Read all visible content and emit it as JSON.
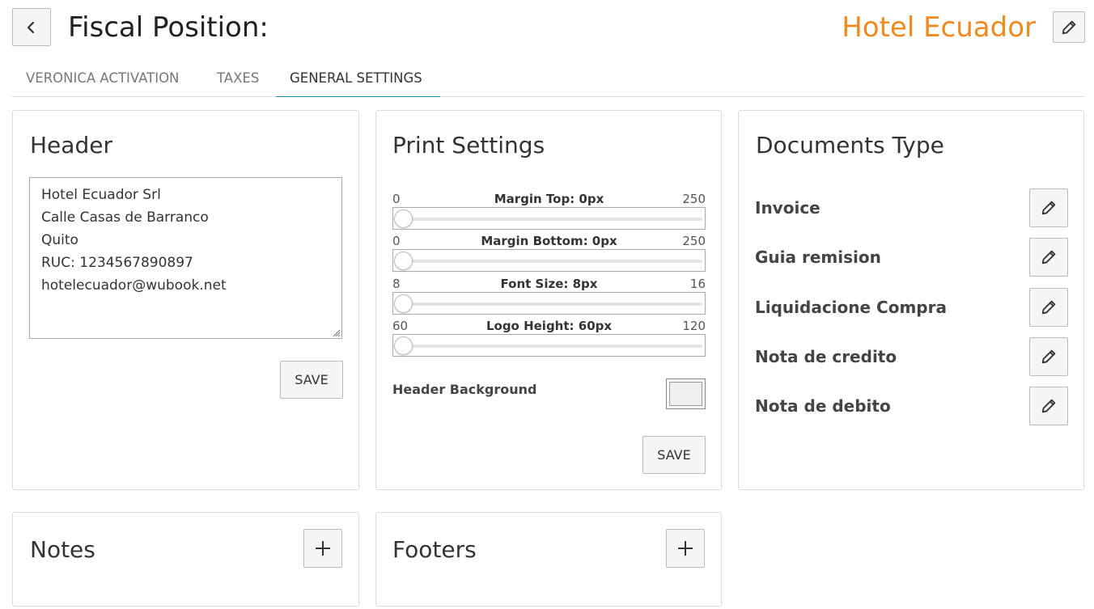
{
  "header": {
    "title": "Fiscal Position:",
    "hotel_name": "Hotel Ecuador"
  },
  "tabs": [
    {
      "label": "VERONICA ACTIVATION",
      "active": false
    },
    {
      "label": "TAXES",
      "active": false
    },
    {
      "label": "GENERAL SETTINGS",
      "active": true
    }
  ],
  "header_card": {
    "title": "Header",
    "text": "Hotel Ecuador Srl\nCalle Casas de Barranco\nQuito\nRUC: 1234567890897\nhotelecuador@wubook.net",
    "save_label": "SAVE"
  },
  "print_settings": {
    "title": "Print Settings",
    "sliders": [
      {
        "label": "Margin Top: 0px",
        "min": "0",
        "max": "250",
        "value": 0
      },
      {
        "label": "Margin Bottom: 0px",
        "min": "0",
        "max": "250",
        "value": 0
      },
      {
        "label": "Font Size: 8px",
        "min": "8",
        "max": "16",
        "value": 8
      },
      {
        "label": "Logo Height: 60px",
        "min": "60",
        "max": "120",
        "value": 60
      }
    ],
    "header_background_label": "Header Background",
    "header_background_color": "#efefef",
    "save_label": "SAVE"
  },
  "documents_type": {
    "title": "Documents Type",
    "items": [
      {
        "label": "Invoice"
      },
      {
        "label": "Guia remision"
      },
      {
        "label": "Liquidacione Compra"
      },
      {
        "label": "Nota de credito"
      },
      {
        "label": "Nota de debito"
      }
    ]
  },
  "notes": {
    "title": "Notes"
  },
  "footers": {
    "title": "Footers"
  },
  "colors": {
    "accent_orange": "#ef8a1e",
    "active_tab_underline": "#1a8c9b"
  },
  "icons": {
    "back": "chevron-left-icon",
    "edit": "pencil-icon",
    "add": "plus-icon"
  }
}
